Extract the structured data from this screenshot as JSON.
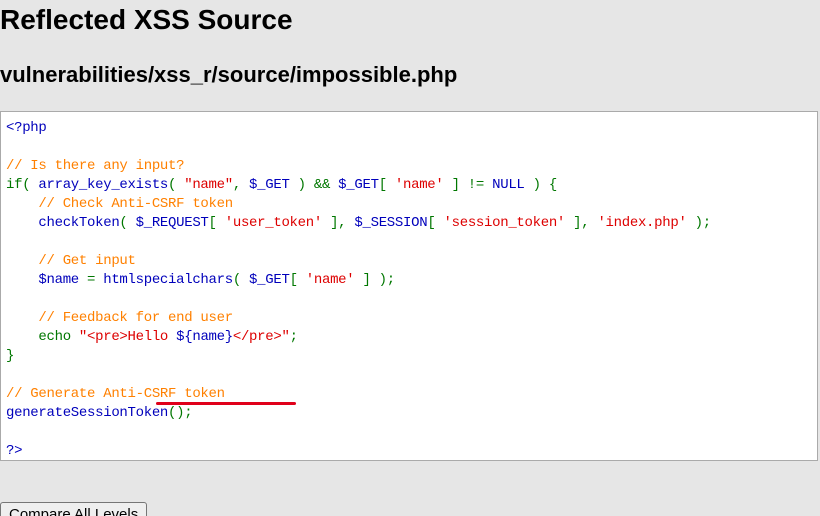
{
  "header": {
    "title": "Reflected XSS Source",
    "file_path": "vulnerabilities/xss_r/source/impossible.php"
  },
  "code_lines": [
    [
      {
        "t": "<?php",
        "c": "df"
      }
    ],
    [],
    [
      {
        "t": "// Is there any input?",
        "c": "cm"
      }
    ],
    [
      {
        "t": "if( ",
        "c": "kw"
      },
      {
        "t": "array_key_exists",
        "c": "df"
      },
      {
        "t": "( ",
        "c": "kw"
      },
      {
        "t": "\"name\"",
        "c": "st"
      },
      {
        "t": ", ",
        "c": "kw"
      },
      {
        "t": "$_GET ",
        "c": "df"
      },
      {
        "t": ") && ",
        "c": "kw"
      },
      {
        "t": "$_GET",
        "c": "df"
      },
      {
        "t": "[ ",
        "c": "kw"
      },
      {
        "t": "'name' ",
        "c": "st"
      },
      {
        "t": "] != ",
        "c": "kw"
      },
      {
        "t": "NULL ",
        "c": "df"
      },
      {
        "t": ") {",
        "c": "kw"
      }
    ],
    [
      {
        "t": "    // Check Anti-CSRF token",
        "c": "cm"
      }
    ],
    [
      {
        "t": "    checkToken",
        "c": "df"
      },
      {
        "t": "( ",
        "c": "kw"
      },
      {
        "t": "$_REQUEST",
        "c": "df"
      },
      {
        "t": "[ ",
        "c": "kw"
      },
      {
        "t": "'user_token' ",
        "c": "st"
      },
      {
        "t": "], ",
        "c": "kw"
      },
      {
        "t": "$_SESSION",
        "c": "df"
      },
      {
        "t": "[ ",
        "c": "kw"
      },
      {
        "t": "'session_token' ",
        "c": "st"
      },
      {
        "t": "], ",
        "c": "kw"
      },
      {
        "t": "'index.php' ",
        "c": "st"
      },
      {
        "t": ");",
        "c": "kw"
      }
    ],
    [],
    [
      {
        "t": "    // Get input",
        "c": "cm"
      }
    ],
    [
      {
        "t": "    $name ",
        "c": "df"
      },
      {
        "t": "= ",
        "c": "kw"
      },
      {
        "t": "htmlspecialchars",
        "c": "df"
      },
      {
        "t": "( ",
        "c": "kw"
      },
      {
        "t": "$_GET",
        "c": "df"
      },
      {
        "t": "[ ",
        "c": "kw"
      },
      {
        "t": "'name' ",
        "c": "st"
      },
      {
        "t": "] );",
        "c": "kw"
      }
    ],
    [],
    [
      {
        "t": "    // Feedback for end user",
        "c": "cm"
      }
    ],
    [
      {
        "t": "    echo ",
        "c": "kw"
      },
      {
        "t": "\"<pre>Hello ",
        "c": "st"
      },
      {
        "t": "${name}",
        "c": "df"
      },
      {
        "t": "</pre>\"",
        "c": "st"
      },
      {
        "t": ";",
        "c": "kw"
      }
    ],
    [
      {
        "t": "}",
        "c": "kw"
      }
    ],
    [],
    [
      {
        "t": "// Generate Anti-CSRF token",
        "c": "cm"
      }
    ],
    [
      {
        "t": "generateSessionToken",
        "c": "df"
      },
      {
        "t": "();",
        "c": "kw"
      }
    ],
    [],
    [
      {
        "t": "?>",
        "c": "df"
      }
    ]
  ],
  "buttons": {
    "compare_all_levels": "Compare All Levels"
  },
  "colors": {
    "keyword": "#007700",
    "comment": "#ff8000",
    "string": "#dd0000",
    "default": "#0000bb",
    "annotation_underline": "#e0001a"
  }
}
